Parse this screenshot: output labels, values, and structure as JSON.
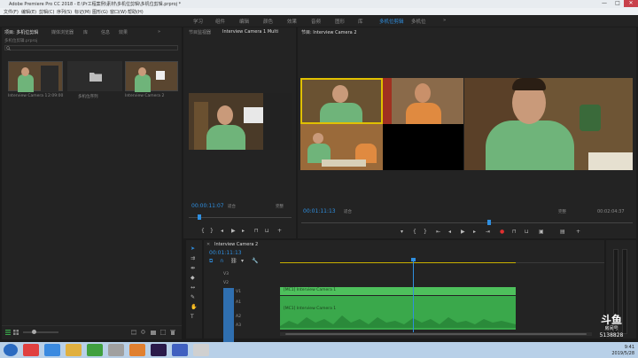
{
  "window": {
    "title": "Adobe Premiere Pro CC 2018 - E:\\Pr工程案例\\素材\\多机位剪辑\\多机位剪辑.prproj *",
    "controls": [
      "—",
      "□",
      "✕"
    ]
  },
  "menu": [
    "文件(F)",
    "编辑(E)",
    "剪辑(C)",
    "序列(S)",
    "标记(M)",
    "图形(G)",
    "窗口(W)",
    "帮助(H)"
  ],
  "workspaces": {
    "items": [
      "学习",
      "组件",
      "编辑",
      "颜色",
      "效果",
      "音频",
      "图形",
      "库",
      "多机位剪辑",
      "多机位",
      "»"
    ],
    "active": "多机位剪辑"
  },
  "project_panel": {
    "tabs": [
      "项目: 多机位剪辑",
      "媒体浏览器",
      "库",
      "信息",
      "效果",
      "»"
    ],
    "path": "多机位剪辑.prproj",
    "items": [
      {
        "name": "Interview Camera 1",
        "duration": "2:09:00"
      },
      {
        "name": "多机位序列",
        "duration": ""
      },
      {
        "name": "Interview Camera 2",
        "duration": "2:09:00"
      }
    ]
  },
  "source_monitor": {
    "tabs": [
      "节目监视器",
      "Interview Camera 1 Multi"
    ],
    "timecode": "00:00:11:07",
    "fit": "适合",
    "scale": "完整"
  },
  "program_monitor": {
    "tab": "节目: Interview Camera 2",
    "timecode": "00:01:11:13",
    "fit": "适合",
    "scale": "完整",
    "duration": "00:02:04:37"
  },
  "timeline": {
    "tab": "Interview Camera 2",
    "timecode": "00:01:11:13",
    "tracks": [
      "V3",
      "V2",
      "V1",
      "A1",
      "A2",
      "A3"
    ],
    "clip_labels": {
      "v1": "[MC1] Interview Camera 1",
      "a1": "[MC1] Interview Camera 1"
    }
  },
  "watermark": {
    "brand": "斗鱼",
    "sub": "房间号",
    "room": "5138828"
  },
  "taskbar": {
    "time": "9:41",
    "date": "2019/5/28"
  }
}
